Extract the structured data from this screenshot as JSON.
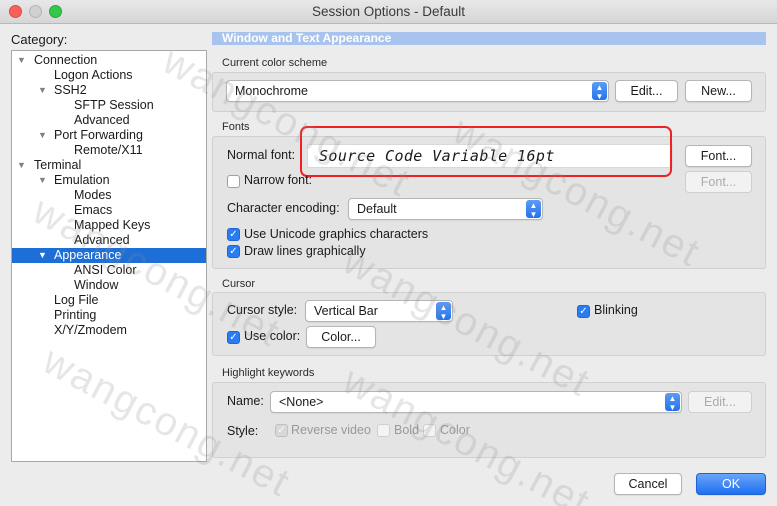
{
  "window": {
    "title": "Session Options - Default"
  },
  "category": {
    "label": "Category:",
    "tree": [
      {
        "label": "Connection",
        "level": 0,
        "expander": "expanded"
      },
      {
        "label": "Logon Actions",
        "level": 1
      },
      {
        "label": "SSH2",
        "level": 1,
        "expander": "expanded"
      },
      {
        "label": "SFTP Session",
        "level": 2
      },
      {
        "label": "Advanced",
        "level": 2
      },
      {
        "label": "Port Forwarding",
        "level": 1,
        "expander": "expanded"
      },
      {
        "label": "Remote/X11",
        "level": 2
      },
      {
        "label": "Terminal",
        "level": 0,
        "expander": "expanded"
      },
      {
        "label": "Emulation",
        "level": 1,
        "expander": "expanded"
      },
      {
        "label": "Modes",
        "level": 2
      },
      {
        "label": "Emacs",
        "level": 2
      },
      {
        "label": "Mapped Keys",
        "level": 2
      },
      {
        "label": "Advanced",
        "level": 2
      },
      {
        "label": "Appearance",
        "level": 1,
        "expander": "expanded",
        "selected": true
      },
      {
        "label": "ANSI Color",
        "level": 2
      },
      {
        "label": "Window",
        "level": 2
      },
      {
        "label": "Log File",
        "level": 1
      },
      {
        "label": "Printing",
        "level": 1
      },
      {
        "label": "X/Y/Zmodem",
        "level": 1
      }
    ]
  },
  "panel": {
    "header": "Window and Text Appearance",
    "color_scheme": {
      "group_label": "Current color scheme",
      "value": "Monochrome",
      "edit_button": "Edit...",
      "new_button": "New..."
    },
    "fonts": {
      "group_label": "Fonts",
      "normal_font_label": "Normal font:",
      "normal_font_value": "Source Code Variable 16pt",
      "font_button": "Font...",
      "narrow_font_label": "Narrow font:",
      "narrow_font_checked": false,
      "narrow_font_button": "Font...",
      "encoding_label": "Character encoding:",
      "encoding_value": "Default",
      "unicode_label": "Use Unicode graphics characters",
      "unicode_checked": true,
      "draw_lines_label": "Draw lines graphically",
      "draw_lines_checked": true
    },
    "cursor": {
      "group_label": "Cursor",
      "style_label": "Cursor style:",
      "style_value": "Vertical Bar",
      "blinking_label": "Blinking",
      "blinking_checked": true,
      "use_color_label": "Use color:",
      "use_color_checked": true,
      "color_button": "Color..."
    },
    "highlight": {
      "group_label": "Highlight keywords",
      "name_label": "Name:",
      "name_value": "<None>",
      "edit_button": "Edit...",
      "style_label": "Style:",
      "reverse_video_label": "Reverse video",
      "reverse_video_checked": true,
      "bold_label": "Bold",
      "bold_checked": false,
      "color_label": "Color",
      "color_checked": false
    }
  },
  "footer": {
    "cancel_button": "Cancel",
    "ok_button": "OK"
  },
  "watermark": "wangcong.net",
  "colors": {
    "accent": "#1d6fd7",
    "section_header": "#a8c4ee",
    "annotation_box": "#ee2222"
  }
}
